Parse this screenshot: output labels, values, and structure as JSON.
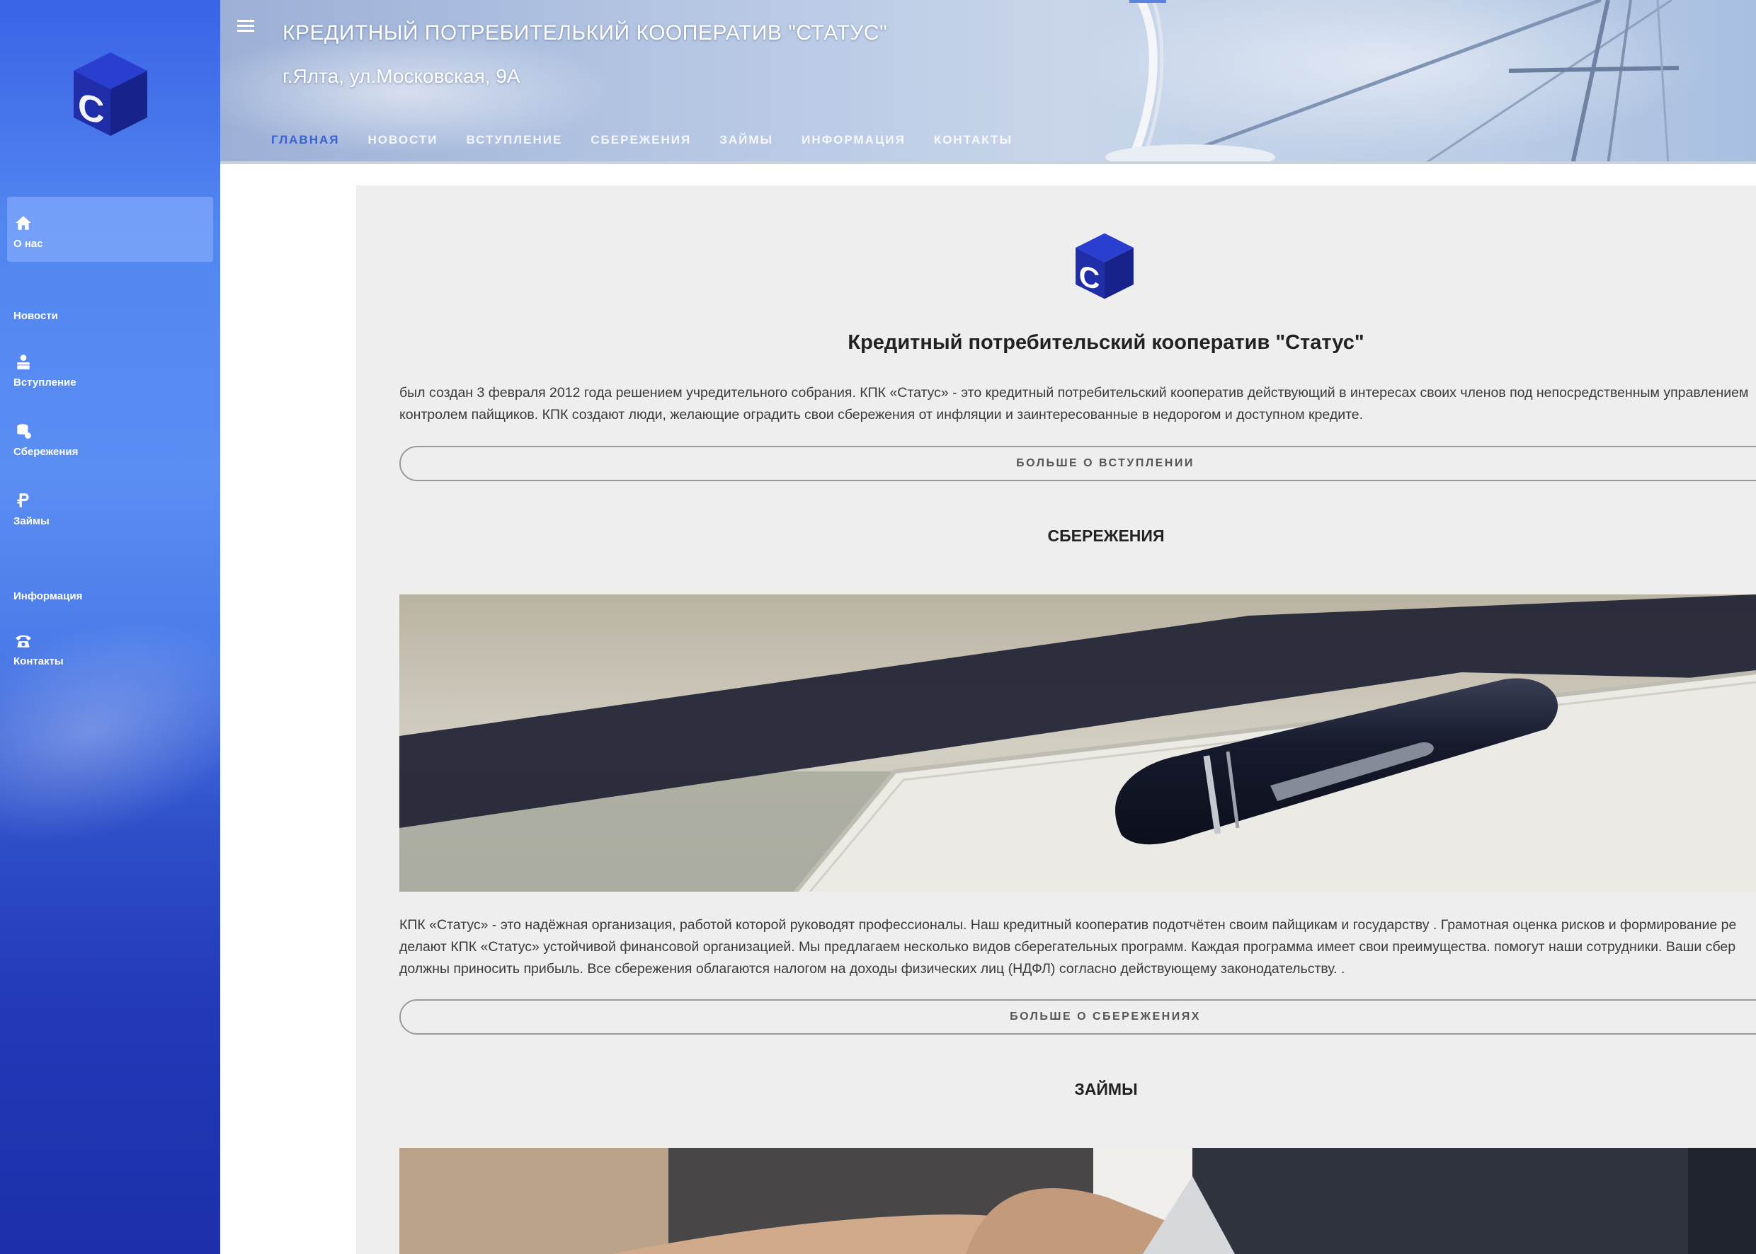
{
  "brand": {
    "logo_letter": "C",
    "accent_color": "#3a62d0",
    "sidebar_color": "#4a7ae8"
  },
  "sidebar": {
    "items": [
      {
        "label": "О нас",
        "icon": "home-icon",
        "active": true
      },
      {
        "label": "Новости",
        "icon": "",
        "active": false
      },
      {
        "label": "Вступление",
        "icon": "person-icon",
        "active": false
      },
      {
        "label": "Сбережения",
        "icon": "coins-icon",
        "active": false
      },
      {
        "label": "Займы",
        "icon": "ruble-icon",
        "active": false
      },
      {
        "label": "Информация",
        "icon": "",
        "active": false
      },
      {
        "label": "Контакты",
        "icon": "phone-icon",
        "active": false
      }
    ]
  },
  "header": {
    "title": "КРЕДИТНЫЙ ПОТРЕБИТЕЛЬКИЙ КООПЕРАТИВ \"СТАТУС\"",
    "address": "г.Ялта, ул.Московская, 9А",
    "tabs": [
      {
        "label": "ГЛАВНАЯ",
        "active": true
      },
      {
        "label": "НОВОСТИ",
        "active": false
      },
      {
        "label": "ВСТУПЛЕНИЕ",
        "active": false
      },
      {
        "label": "СБЕРЕЖЕНИЯ",
        "active": false
      },
      {
        "label": "ЗАЙМЫ",
        "active": false
      },
      {
        "label": "ИНФОРМАЦИЯ",
        "active": false
      },
      {
        "label": "КОНТАКТЫ",
        "active": false
      }
    ]
  },
  "main": {
    "title": "Кредитный потребительский кооператив \"Статус\"",
    "intro_lines": [
      "был создан 3 февраля 2012 года решением учредительного собрания. КПК «Статус» - это кредитный потребительский кооператив действующий в интересах своих членов под непосредственным управлением",
      "контролем пайщиков. КПК создают люди, желающие оградить свои сбережения от инфляции и заинтересованные в недорогом и доступном кредите."
    ],
    "join_button": "БОЛЬШЕ О ВСТУПЛЕНИИ",
    "savings": {
      "heading": "СБЕРЕЖЕНИЯ",
      "lines": [
        "КПК «Статус» - это надёжная организация, работой которой руководят профессионалы. Наш кредитный кооператив подотчётен своим пайщикам и государству . Грамотная оценка рисков и формирование ре",
        "делают КПК «Статус» устойчивой финансовой организацией. Мы предлагаем несколько видов сберегательных программ. Каждая программа имеет свои преимущества. помогут наши сотрудники. Ваши сбер",
        "должны приносить прибыль. Все сбережения облагаются налогом на доходы физических лиц (НДФЛ) согласно действующему законодательству. ."
      ],
      "button": "БОЛЬШЕ О СБЕРЕЖЕНИЯХ"
    },
    "loans": {
      "heading": "ЗАЙМЫ"
    }
  }
}
